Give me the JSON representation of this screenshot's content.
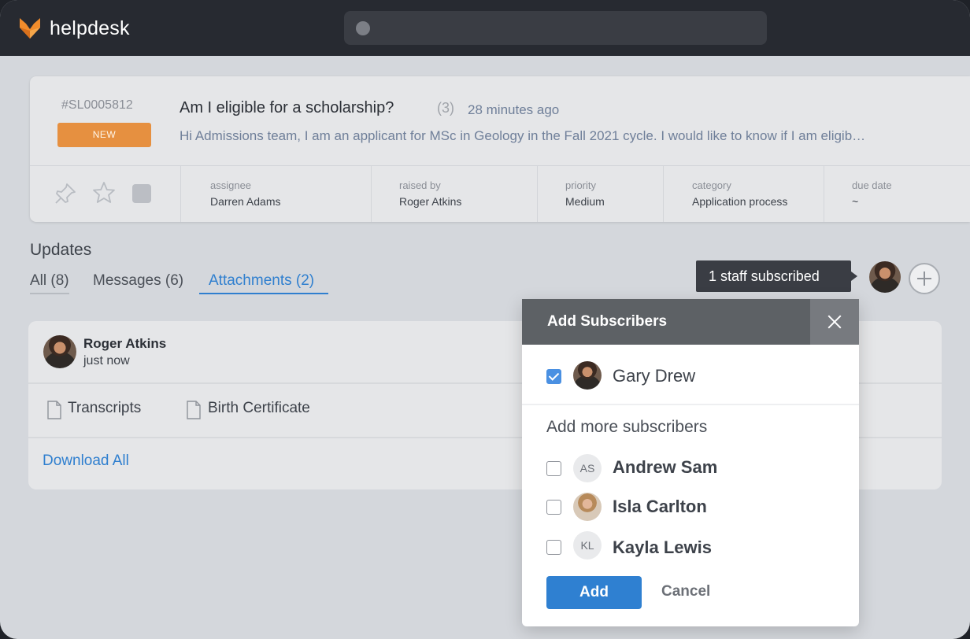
{
  "app": {
    "brand": "helpdesk",
    "search": {
      "placeholder": ""
    }
  },
  "ticket": {
    "id": "#SL0005812",
    "status": "NEW",
    "title": "Am I eligible for a scholarship?",
    "reply_count": "(3)",
    "time": "28 minutes ago",
    "snippet": "Hi Admissions team, I am an applicant for MSc in Geology in the Fall 2021 cycle. I would like to know if I am eligib…",
    "meta": [
      {
        "label": "assignee",
        "value": "Darren Adams"
      },
      {
        "label": "raised by",
        "value": "Roger Atkins"
      },
      {
        "label": "priority",
        "value": "Medium"
      },
      {
        "label": "category",
        "value": "Application process"
      },
      {
        "label": "due date",
        "value": "~"
      }
    ],
    "icons": [
      "pin-icon",
      "star-icon",
      "square-icon"
    ]
  },
  "updates": {
    "title": "Updates",
    "tabs": [
      {
        "label": "All (8)"
      },
      {
        "label": "Messages (6)"
      },
      {
        "label": "Attachments (2)"
      }
    ],
    "active_tab": "Attachments (2)",
    "staff_subscribed": "1 staff subscribed"
  },
  "attachment_post": {
    "author": "Roger Atkins",
    "time": "just now",
    "files": [
      "Transcripts",
      "Birth Certificate"
    ],
    "download_all": "Download All"
  },
  "modal": {
    "title": "Add Subscribers",
    "current": [
      {
        "name": "Gary Drew",
        "checked": true
      }
    ],
    "more_label": "Add more subscribers",
    "candidates": [
      {
        "name": "Andrew Sam",
        "initials": "AS",
        "checked": false
      },
      {
        "name": "Isla Carlton",
        "initials": "",
        "checked": false
      },
      {
        "name": "Kayla Lewis",
        "initials": "KL",
        "checked": false
      }
    ],
    "add_label": "Add",
    "cancel_label": "Cancel"
  },
  "colors": {
    "accent": "#2f80d1",
    "badge": "#e69040",
    "topbar": "#272a31",
    "modal_header": "#5d6165"
  }
}
